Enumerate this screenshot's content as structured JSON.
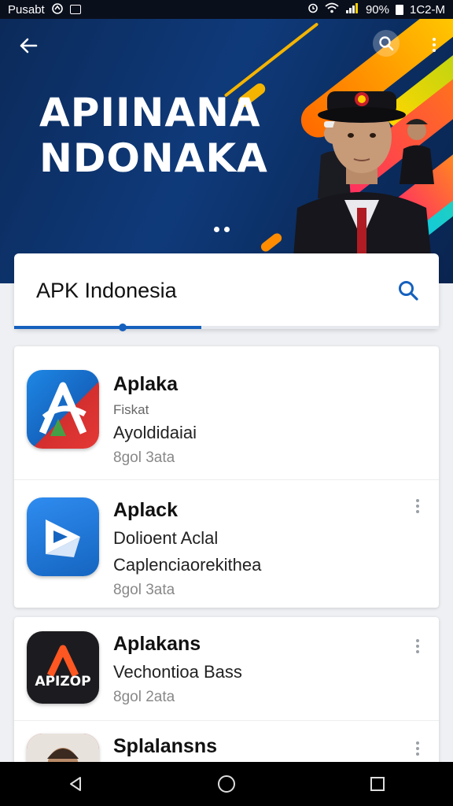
{
  "status_bar": {
    "carrier": "Pusabt",
    "battery_percent": "90%",
    "time": "1C2-M"
  },
  "hero": {
    "title_line1": "APIINANA",
    "title_line2": "NDONAKA",
    "carousel_pages": 2,
    "colors": {
      "background": "#0b2a5a",
      "accent_orange": "#ff6a00",
      "accent_yellow": "#ffd000",
      "accent_green": "#7ed321",
      "accent_pink": "#ff2e63"
    }
  },
  "search": {
    "query": "APK Indonesia",
    "progress": 0.44,
    "accent": "#1560bd"
  },
  "apps": [
    {
      "name": "Aplaka",
      "line1": "Fiskat",
      "line2": "Ayoldidaiai",
      "meta": "8gol 3ata",
      "icon": "aplaka-icon"
    },
    {
      "name": "Aplack",
      "line1": "Dolioent Aclal",
      "line2": "Caplenciaorekithea",
      "meta": "8gol 3ata",
      "icon": "play-icon"
    },
    {
      "name": "Aplakans",
      "line1": "Vechontioa Bass",
      "meta": "8gol 2ata",
      "icon": "apizop-icon",
      "icon_text": "APIZOP"
    },
    {
      "name": "Splalansns",
      "icon": "portrait-icon"
    }
  ]
}
